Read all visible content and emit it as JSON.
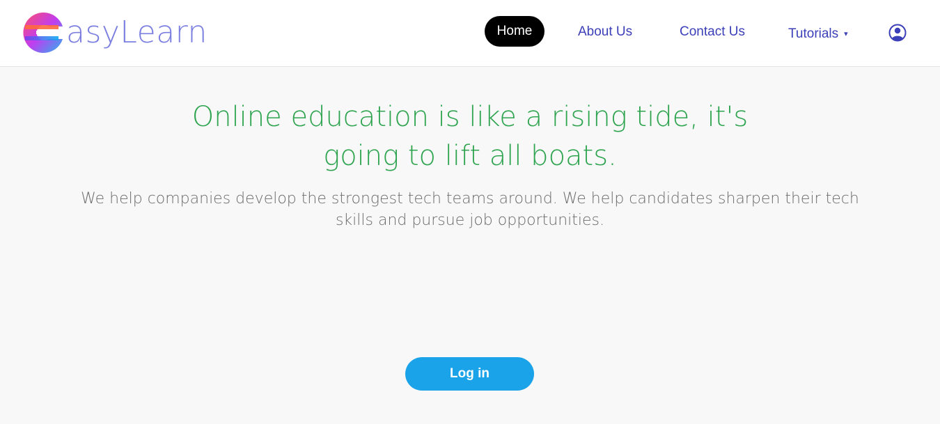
{
  "brand": {
    "logo_text": "asyLearn",
    "logo_icon": "easylearn-logo-icon"
  },
  "nav": {
    "items": [
      {
        "label": "Home",
        "active": true
      },
      {
        "label": "About Us"
      },
      {
        "label": "Contact Us"
      },
      {
        "label": "Tutorials",
        "has_dropdown": true
      }
    ],
    "dropdown_caret": "▾",
    "user_icon": "user-circle-icon"
  },
  "hero": {
    "headline": "Online education is like a rising tide, it's going to lift all boats.",
    "subtext": "We help companies develop the strongest tech teams around. We help candidates sharpen their tech skills and pursue job opportunities.",
    "login_label": "Log in"
  },
  "colors": {
    "nav_link": "#3b3fb8",
    "active_bg": "#000000",
    "headline": "#2ea44f",
    "login_bg": "#1aa3e8",
    "page_bg": "#f8f8f8"
  }
}
